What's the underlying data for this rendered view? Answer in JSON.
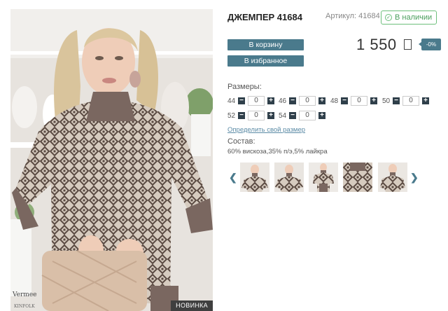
{
  "product": {
    "title": "ДЖЕМПЕР 41684",
    "sku": "Артикул: 41684",
    "stock": "В наличии",
    "price": "1 550",
    "discount": "-0%",
    "badge": "НОВИНКА"
  },
  "buttons": {
    "cart": "В корзину",
    "favorites": "В избранное"
  },
  "sizes": {
    "label": "Размеры:",
    "items": [
      {
        "size": "44",
        "qty": "0"
      },
      {
        "size": "46",
        "qty": "0"
      },
      {
        "size": "48",
        "qty": "0"
      },
      {
        "size": "50",
        "qty": "0"
      },
      {
        "size": "52",
        "qty": "0"
      },
      {
        "size": "54",
        "qty": "0"
      }
    ],
    "minus_symbol": "−",
    "plus_symbol": "+"
  },
  "size_link": "Определить свой размер",
  "composition": {
    "label": "Состав:",
    "value": "60% вискоза,35% п/э,5% лайкра"
  },
  "thumbnails": {
    "count": 5,
    "left_arrow": "❮",
    "right_arrow": "❯"
  },
  "photo_text": {
    "vase_brand": "Vermee",
    "book_brand": "KINFOLK"
  },
  "colors": {
    "accent": "#4a7a8c",
    "stock_green": "#4a9e5c",
    "sweater": "#c8bcb0",
    "pattern": "#5a4a42",
    "collar": "#7a6760",
    "bag": "#d9bfa8"
  }
}
